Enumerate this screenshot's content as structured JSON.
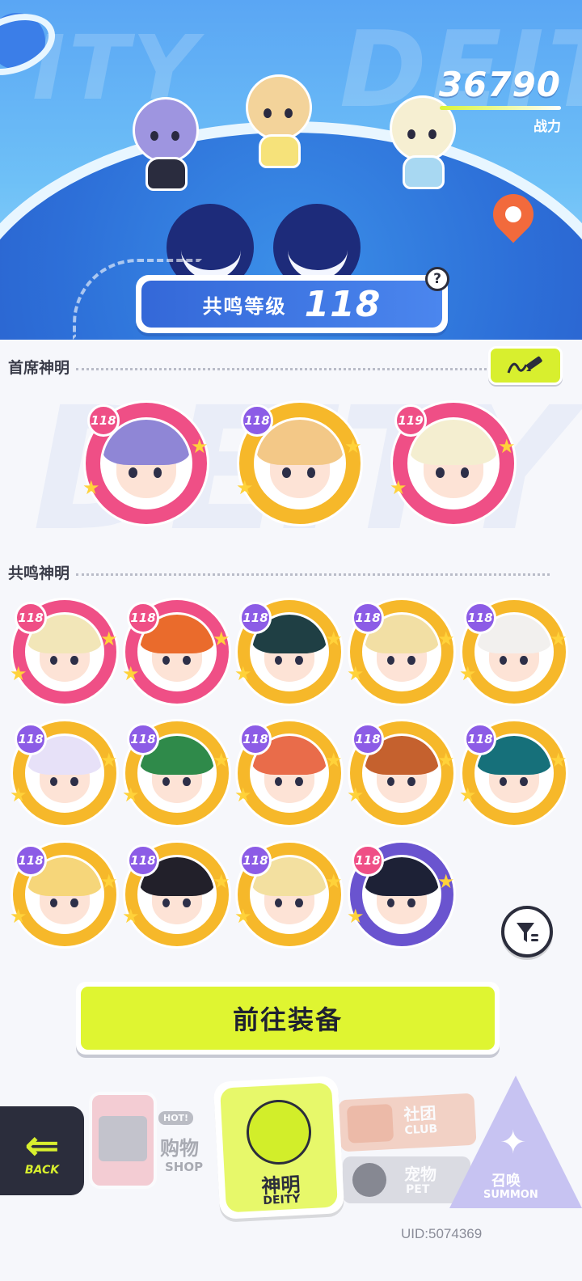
{
  "hero": {
    "power_value": "36790",
    "power_label": "战力",
    "resonance_label": "共鸣等级",
    "resonance_level": "118",
    "help_symbol": "?",
    "bg_words": [
      "ITY",
      "DEIT"
    ]
  },
  "sections": {
    "chief_title": "首席神明",
    "resonance_title": "共鸣神明"
  },
  "chief_deities": [
    {
      "level": "118",
      "frame": "#ef4f86",
      "hair": "#8f86d6"
    },
    {
      "level": "118",
      "frame": "#f6b82a",
      "hair": "#f3c887"
    },
    {
      "level": "119",
      "frame": "#ef4f86",
      "hair": "#f4eed0"
    }
  ],
  "resonance_deities": [
    {
      "level": "118",
      "frame": "#ef4f86",
      "hair": "#f2e6b8"
    },
    {
      "level": "118",
      "frame": "#ef4f86",
      "hair": "#ea6b2c"
    },
    {
      "level": "118",
      "frame": "#f6b82a",
      "hair": "#1f3f44"
    },
    {
      "level": "118",
      "frame": "#f6b82a",
      "hair": "#f2dfa4"
    },
    {
      "level": "118",
      "frame": "#f6b82a",
      "hair": "#f2f0ee"
    },
    {
      "level": "118",
      "frame": "#f6b82a",
      "hair": "#e7e1f8"
    },
    {
      "level": "118",
      "frame": "#f6b82a",
      "hair": "#2f8a4a"
    },
    {
      "level": "118",
      "frame": "#f6b82a",
      "hair": "#e96c4a"
    },
    {
      "level": "118",
      "frame": "#f6b82a",
      "hair": "#c5612e"
    },
    {
      "level": "118",
      "frame": "#f6b82a",
      "hair": "#16707a"
    },
    {
      "level": "118",
      "frame": "#f6b82a",
      "hair": "#f6d67a"
    },
    {
      "level": "118",
      "frame": "#f6b82a",
      "hair": "#22202a"
    },
    {
      "level": "118",
      "frame": "#f6b82a",
      "hair": "#f3e0a0"
    },
    {
      "level": "118",
      "frame": "#6a54cf",
      "hair": "#1d2136"
    }
  ],
  "badge_colors": {
    "purple": "#8c5ce6",
    "pink": "#ef4f86"
  },
  "actions": {
    "equip_label": "前往装备"
  },
  "nav": {
    "back_label": "BACK",
    "shop_cn": "购物",
    "shop_en": "SHOP",
    "shop_hot": "HOT!",
    "deity_cn": "神明",
    "deity_en": "DEITY",
    "club_cn": "社团",
    "club_en": "CLUB",
    "pet_cn": "宠物",
    "pet_en": "PET",
    "summon_cn": "召唤",
    "summon_en": "SUMMON"
  },
  "uid": "UID:5074369",
  "colors": {
    "accent_lime": "#d8ef2e",
    "dark": "#2b2d3c",
    "blue": "#3468d8"
  },
  "icons": [
    "back-arrow-icon",
    "edit-pencil-icon",
    "filter-icon",
    "help-icon",
    "location-pin-icon",
    "lock-icon",
    "star-icon"
  ]
}
